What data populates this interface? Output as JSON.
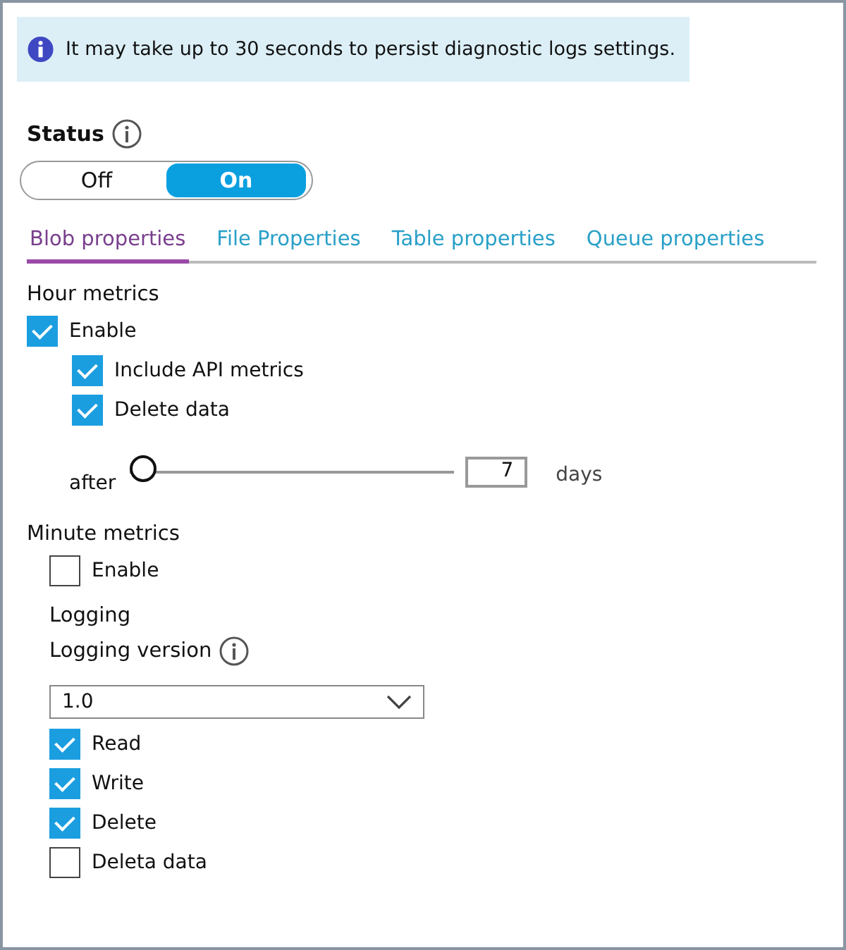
{
  "banner": {
    "text": "It may take up to 30 seconds to persist diagnostic logs settings."
  },
  "status": {
    "label": "Status",
    "options": [
      {
        "label": "Off",
        "selected": false
      },
      {
        "label": "On",
        "selected": true
      }
    ]
  },
  "tabs": [
    {
      "label": "Blob properties",
      "selected": true
    },
    {
      "label": "File Properties",
      "selected": false
    },
    {
      "label": "Table properties",
      "selected": false
    },
    {
      "label": "Queue properties",
      "selected": false
    }
  ],
  "hour_metrics": {
    "title": "Hour metrics",
    "checkboxes": [
      {
        "label": "Enable",
        "checked": true,
        "children": [
          {
            "label": "Include API metrics",
            "checked": true
          },
          {
            "label": "Delete data",
            "checked": true
          }
        ]
      }
    ],
    "retention": {
      "prefix": "after",
      "level": 0,
      "value": "7",
      "suffix": "days"
    }
  },
  "minute_metrics": {
    "title": "Minute metrics",
    "checkboxes": [
      {
        "label": "Enable",
        "checked": false
      }
    ]
  },
  "logging": {
    "title": "Logging",
    "version_label": "Logging version",
    "version": "1.0",
    "checkboxes": [
      {
        "label": "Read",
        "checked": true
      },
      {
        "label": "Write",
        "checked": true
      },
      {
        "label": "Delete",
        "checked": true
      },
      {
        "label": "Deleta data",
        "checked": false
      }
    ]
  }
}
